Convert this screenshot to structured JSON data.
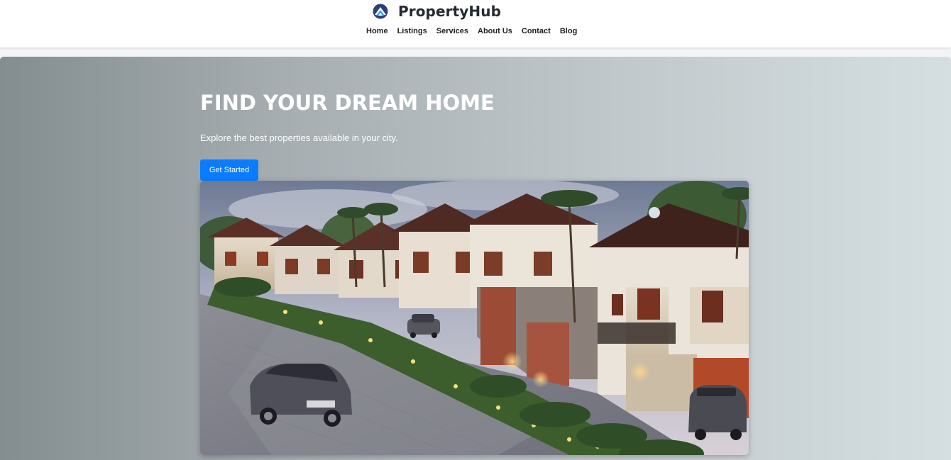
{
  "header": {
    "brand_name": "PropertyHub",
    "logo_icon": "house-mountain-logo-icon",
    "nav": [
      {
        "label": "Home"
      },
      {
        "label": "Listings"
      },
      {
        "label": "Services"
      },
      {
        "label": "About Us"
      },
      {
        "label": "Contact"
      },
      {
        "label": "Blog"
      }
    ]
  },
  "hero": {
    "title": "FIND YOUR DREAM HOME",
    "subtitle": "Explore the best properties available in your city.",
    "cta_label": "Get Started",
    "image_alt": "Residential villa street at dusk with parked cars and landscaped gardens"
  },
  "colors": {
    "brand_dark": "#222a33",
    "accent_blue": "#0a7cff",
    "hero_gradient_start": "#848d8f",
    "hero_gradient_end": "#d5dfe1"
  }
}
